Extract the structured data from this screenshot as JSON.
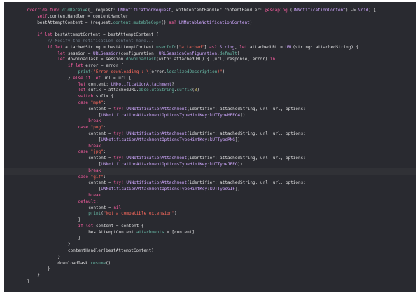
{
  "window": {
    "title": ""
  },
  "colors": {
    "background": "#292a30",
    "plain": "#dfdfe0",
    "keyword": "#fc5fa3",
    "type": "#d0a8ff",
    "other_type": "#a167e6",
    "function": "#67b7a4",
    "property": "#67b7a4",
    "string": "#fc6a5d",
    "comment": "#6c7986",
    "number": "#d0bf69",
    "current_line": "#303136"
  },
  "editor": {
    "current_line_index": 26,
    "lines": [
      {
        "indent": 4,
        "tokens": [
          [
            "keyword",
            "override func "
          ],
          [
            "function",
            "didReceive"
          ],
          [
            "plain",
            "(_ request: "
          ],
          [
            "type",
            "UNNotificationRequest"
          ],
          [
            "plain",
            ", withContentHandler contentHandler: "
          ],
          [
            "keyword",
            "@escaping"
          ],
          [
            "plain",
            " ("
          ],
          [
            "type",
            "UNNotificationContent"
          ],
          [
            "plain",
            ") -> "
          ],
          [
            "type",
            "Void"
          ],
          [
            "plain",
            ") {"
          ]
        ]
      },
      {
        "indent": 8,
        "tokens": [
          [
            "keyword",
            "self"
          ],
          [
            "plain",
            ".contentHandler = contentHandler"
          ]
        ]
      },
      {
        "indent": 8,
        "tokens": [
          [
            "plain",
            "bestAttemptContent = (request."
          ],
          [
            "property",
            "content"
          ],
          [
            "plain",
            "."
          ],
          [
            "function",
            "mutableCopy"
          ],
          [
            "plain",
            "() "
          ],
          [
            "keyword",
            "as?"
          ],
          [
            "plain",
            " "
          ],
          [
            "type",
            "UNMutableNotificationContent"
          ],
          [
            "plain",
            ")"
          ]
        ]
      },
      {
        "indent": 0,
        "tokens": []
      },
      {
        "indent": 8,
        "tokens": [
          [
            "keyword",
            "if let"
          ],
          [
            "plain",
            " bestAttemptContent = bestAttemptContent {"
          ]
        ]
      },
      {
        "indent": 12,
        "tokens": [
          [
            "comment",
            "// Modify the notification content here..."
          ]
        ]
      },
      {
        "indent": 12,
        "tokens": [
          [
            "keyword",
            "if let"
          ],
          [
            "plain",
            " attachedString = bestAttemptContent."
          ],
          [
            "property",
            "userInfo"
          ],
          [
            "plain",
            "["
          ],
          [
            "string",
            "\"attached\""
          ],
          [
            "plain",
            "] "
          ],
          [
            "keyword",
            "as?"
          ],
          [
            "plain",
            " "
          ],
          [
            "type",
            "String"
          ],
          [
            "plain",
            ", "
          ],
          [
            "keyword",
            "let"
          ],
          [
            "plain",
            " attachedURL = "
          ],
          [
            "type",
            "URL"
          ],
          [
            "plain",
            "(string: attachedString) {"
          ]
        ]
      },
      {
        "indent": 16,
        "tokens": [
          [
            "keyword",
            "let"
          ],
          [
            "plain",
            " session = "
          ],
          [
            "type",
            "URLSession"
          ],
          [
            "plain",
            "(configuration: "
          ],
          [
            "type",
            "URLSessionConfiguration"
          ],
          [
            "plain",
            "."
          ],
          [
            "property",
            "default"
          ],
          [
            "plain",
            ")"
          ]
        ]
      },
      {
        "indent": 16,
        "tokens": [
          [
            "keyword",
            "let"
          ],
          [
            "plain",
            " downloadTask = session."
          ],
          [
            "function",
            "downloadTask"
          ],
          [
            "plain",
            "(with: attachedURL) { (url, response, error) "
          ],
          [
            "keyword",
            "in"
          ]
        ]
      },
      {
        "indent": 20,
        "tokens": [
          [
            "keyword",
            "if let"
          ],
          [
            "plain",
            " error = error {"
          ]
        ]
      },
      {
        "indent": 24,
        "tokens": [
          [
            "function",
            "print"
          ],
          [
            "plain",
            "("
          ],
          [
            "string",
            "\"Error downloading : \\("
          ],
          [
            "plain",
            "error."
          ],
          [
            "property",
            "localizedDescription"
          ],
          [
            "string",
            ")\""
          ],
          [
            "plain",
            ")"
          ]
        ]
      },
      {
        "indent": 20,
        "tokens": [
          [
            "plain",
            "} "
          ],
          [
            "keyword",
            "else if let"
          ],
          [
            "plain",
            " url = url {"
          ]
        ]
      },
      {
        "indent": 24,
        "tokens": [
          [
            "keyword",
            "let"
          ],
          [
            "plain",
            " content: "
          ],
          [
            "type",
            "UNNotificationAttachment"
          ],
          [
            "plain",
            "?"
          ]
        ]
      },
      {
        "indent": 24,
        "tokens": [
          [
            "keyword",
            "let"
          ],
          [
            "plain",
            " sufix = attachedURL."
          ],
          [
            "property",
            "absoluteString"
          ],
          [
            "plain",
            "."
          ],
          [
            "function",
            "suffix"
          ],
          [
            "plain",
            "("
          ],
          [
            "number",
            "3"
          ],
          [
            "plain",
            ")"
          ]
        ]
      },
      {
        "indent": 24,
        "tokens": [
          [
            "keyword",
            "switch"
          ],
          [
            "plain",
            " sufix {"
          ]
        ]
      },
      {
        "indent": 24,
        "tokens": [
          [
            "keyword",
            "case"
          ],
          [
            "plain",
            " "
          ],
          [
            "string",
            "\"mp4\""
          ],
          [
            "plain",
            ":"
          ]
        ]
      },
      {
        "indent": 28,
        "tokens": [
          [
            "plain",
            "content = "
          ],
          [
            "keyword",
            "try!"
          ],
          [
            "plain",
            " "
          ],
          [
            "type",
            "UNNotificationAttachment"
          ],
          [
            "plain",
            "(identifier: attachedString, url: url, options:"
          ]
        ]
      },
      {
        "indent": 32,
        "tokens": [
          [
            "plain",
            "["
          ],
          [
            "type",
            "UNNotificationAttachmentOptionsTypeHintKey"
          ],
          [
            "plain",
            ":"
          ],
          [
            "type",
            "kUTTypeMPEG4"
          ],
          [
            "plain",
            "])"
          ]
        ]
      },
      {
        "indent": 28,
        "tokens": [
          [
            "keyword",
            "break"
          ]
        ]
      },
      {
        "indent": 24,
        "tokens": [
          [
            "keyword",
            "case"
          ],
          [
            "plain",
            " "
          ],
          [
            "string",
            "\"png\""
          ],
          [
            "plain",
            ":"
          ]
        ]
      },
      {
        "indent": 28,
        "tokens": [
          [
            "plain",
            "content = "
          ],
          [
            "keyword",
            "try!"
          ],
          [
            "plain",
            " "
          ],
          [
            "type",
            "UNNotificationAttachment"
          ],
          [
            "plain",
            "(identifier: attachedString, url: url, options:"
          ]
        ]
      },
      {
        "indent": 32,
        "tokens": [
          [
            "plain",
            "["
          ],
          [
            "type",
            "UNNotificationAttachmentOptionsTypeHintKey"
          ],
          [
            "plain",
            ":"
          ],
          [
            "type",
            "kUTTypePNG"
          ],
          [
            "plain",
            "])"
          ]
        ]
      },
      {
        "indent": 28,
        "tokens": [
          [
            "keyword",
            "break"
          ]
        ]
      },
      {
        "indent": 24,
        "tokens": [
          [
            "keyword",
            "case"
          ],
          [
            "plain",
            " "
          ],
          [
            "string",
            "\"jpg\""
          ],
          [
            "plain",
            ":"
          ]
        ]
      },
      {
        "indent": 28,
        "tokens": [
          [
            "plain",
            "content = "
          ],
          [
            "keyword",
            "try!"
          ],
          [
            "plain",
            " "
          ],
          [
            "type",
            "UNNotificationAttachment"
          ],
          [
            "plain",
            "(identifier: attachedString, url: url, options:"
          ]
        ]
      },
      {
        "indent": 32,
        "tokens": [
          [
            "plain",
            "["
          ],
          [
            "type",
            "UNNotificationAttachmentOptionsTypeHintKey"
          ],
          [
            "plain",
            ":"
          ],
          [
            "type",
            "kUTTypeJPEG"
          ],
          [
            "plain",
            "])"
          ]
        ]
      },
      {
        "indent": 28,
        "tokens": [
          [
            "keyword",
            "break"
          ]
        ]
      },
      {
        "indent": 24,
        "tokens": [
          [
            "keyword",
            "case"
          ],
          [
            "plain",
            " "
          ],
          [
            "string",
            "\"gif\""
          ],
          [
            "plain",
            ":"
          ]
        ]
      },
      {
        "indent": 28,
        "tokens": [
          [
            "plain",
            "content = "
          ],
          [
            "keyword",
            "try!"
          ],
          [
            "plain",
            " "
          ],
          [
            "type",
            "UNNotificationAttachment"
          ],
          [
            "plain",
            "(identifier: attachedString, url: url, options:"
          ]
        ]
      },
      {
        "indent": 32,
        "tokens": [
          [
            "plain",
            "["
          ],
          [
            "type",
            "UNNotificationAttachmentOptionsTypeHintKey"
          ],
          [
            "plain",
            ":"
          ],
          [
            "type",
            "kUTTypeGIF"
          ],
          [
            "plain",
            "])"
          ]
        ]
      },
      {
        "indent": 28,
        "tokens": [
          [
            "keyword",
            "break"
          ]
        ]
      },
      {
        "indent": 24,
        "tokens": [
          [
            "keyword",
            "default"
          ],
          [
            "plain",
            ":"
          ]
        ]
      },
      {
        "indent": 28,
        "tokens": [
          [
            "plain",
            "content = "
          ],
          [
            "keyword",
            "nil"
          ]
        ]
      },
      {
        "indent": 28,
        "tokens": [
          [
            "function",
            "print"
          ],
          [
            "plain",
            "("
          ],
          [
            "string",
            "\"Not a compatible extension\""
          ],
          [
            "plain",
            ")"
          ]
        ]
      },
      {
        "indent": 24,
        "tokens": [
          [
            "plain",
            "}"
          ]
        ]
      },
      {
        "indent": 24,
        "tokens": [
          [
            "keyword",
            "if let"
          ],
          [
            "plain",
            " content = content {"
          ]
        ]
      },
      {
        "indent": 28,
        "tokens": [
          [
            "plain",
            "bestAttemptContent."
          ],
          [
            "property",
            "attachments"
          ],
          [
            "plain",
            " = [content]"
          ]
        ]
      },
      {
        "indent": 24,
        "tokens": [
          [
            "plain",
            "}"
          ]
        ]
      },
      {
        "indent": 20,
        "tokens": [
          [
            "plain",
            "}"
          ]
        ]
      },
      {
        "indent": 20,
        "tokens": [
          [
            "plain",
            "contentHandler(bestAttemptContent)"
          ]
        ]
      },
      {
        "indent": 16,
        "tokens": [
          [
            "plain",
            "}"
          ]
        ]
      },
      {
        "indent": 16,
        "tokens": [
          [
            "plain",
            "downloadTask."
          ],
          [
            "function",
            "resume"
          ],
          [
            "plain",
            "()"
          ]
        ]
      },
      {
        "indent": 12,
        "tokens": [
          [
            "plain",
            "}"
          ]
        ]
      },
      {
        "indent": 8,
        "tokens": [
          [
            "plain",
            "}"
          ]
        ]
      },
      {
        "indent": 4,
        "tokens": [
          [
            "plain",
            "}"
          ]
        ]
      }
    ]
  }
}
